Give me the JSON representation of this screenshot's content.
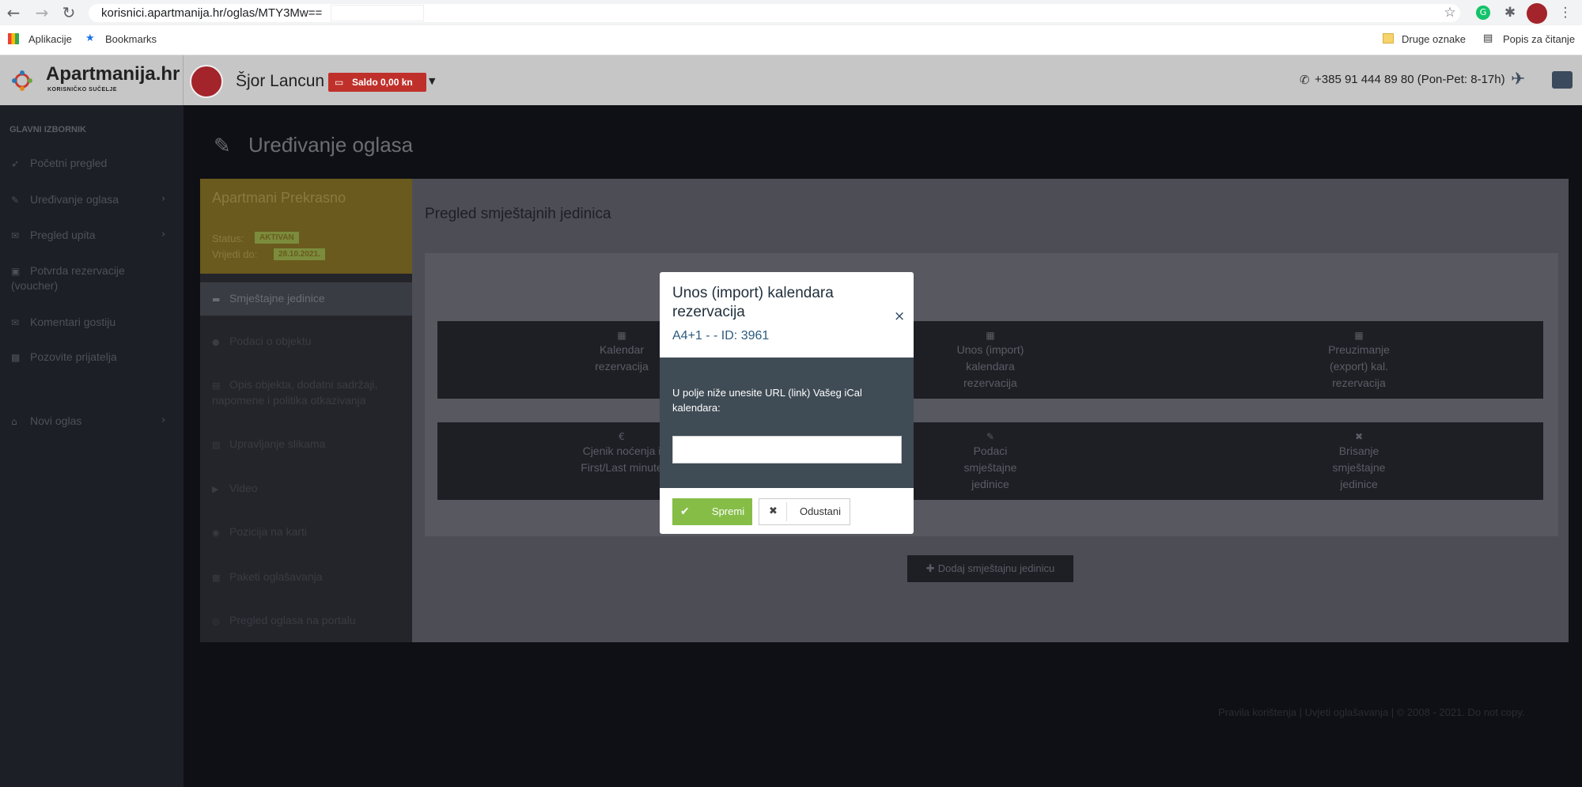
{
  "browser": {
    "url": "korisnici.apartmanija.hr/oglas/MTY3Mw==",
    "bookmarks": {
      "apps_label": "Aplikacije",
      "bookmarks_label": "Bookmarks",
      "other_label": "Druge oznake",
      "reading_label": "Popis za čitanje"
    }
  },
  "header": {
    "logo_text": "Apartmanija.hr",
    "logo_sub": "KORISNIČKO SUČELJE",
    "user_name": "Šjor Lancun",
    "saldo": "Saldo 0,00 kn",
    "phone": "+385 91 444 89 80 (Pon-Pet: 8-17h)"
  },
  "sidebar": {
    "heading": "GLAVNI IZBORNIK",
    "items": [
      {
        "label": "Početni pregled"
      },
      {
        "label": "Uređivanje oglasa"
      },
      {
        "label": "Pregled upita"
      },
      {
        "label": "Potvrda rezervacije (voucher)"
      },
      {
        "label": "Komentari gostiju"
      },
      {
        "label": "Pozovite prijatelja"
      },
      {
        "label": "Novi oglas"
      }
    ]
  },
  "main": {
    "page_title": "Uređivanje oglasa",
    "apartment_name": "Apartmani  Prekrasno",
    "status_label": "Status:",
    "status_value": "AKTIVAN",
    "date_label": "Vrijedi do:",
    "date_value": "28.10.2021.",
    "left_menu": [
      {
        "label": "Smještajne jedinice"
      },
      {
        "label": "Podaci o objektu"
      },
      {
        "label": "Opis objekta, dodatni sadržaji, napomene i politika otkazivanja"
      },
      {
        "label": "Upravljanje slikama"
      },
      {
        "label": "Video"
      },
      {
        "label": "Pozicija na karti"
      },
      {
        "label": "Paketi oglašavanja"
      },
      {
        "label": "Pregled oglasa na portalu"
      }
    ],
    "section_title": "Pregled smještajnih jedinica",
    "unit_buttons": [
      {
        "label": "Kalendar rezervacija"
      },
      {
        "label": "Unos (import) kalendara rezervacija"
      },
      {
        "label": "Preuzimanje (export) kal. rezervacija"
      },
      {
        "label": "Cjenik noćenja i First/Last minute"
      },
      {
        "label": "Podaci smještajne jedinice"
      },
      {
        "label": "Brisanje smještajne jedinice"
      }
    ],
    "add_unit": "Dodaj smještajnu jedinicu",
    "footer": "Pravila korištenja | Uvjeti oglašavanja | © 2008 - 2021. Do not copy."
  },
  "modal": {
    "title": "Unos (import) kalendara rezervacija",
    "subtitle": "A4+1 - - ID: 3961",
    "text": "U polje niže unesite URL (link) Vašeg iCal kalendara:",
    "input_value": "",
    "save_label": "Spremi",
    "cancel_label": "Odustani"
  }
}
